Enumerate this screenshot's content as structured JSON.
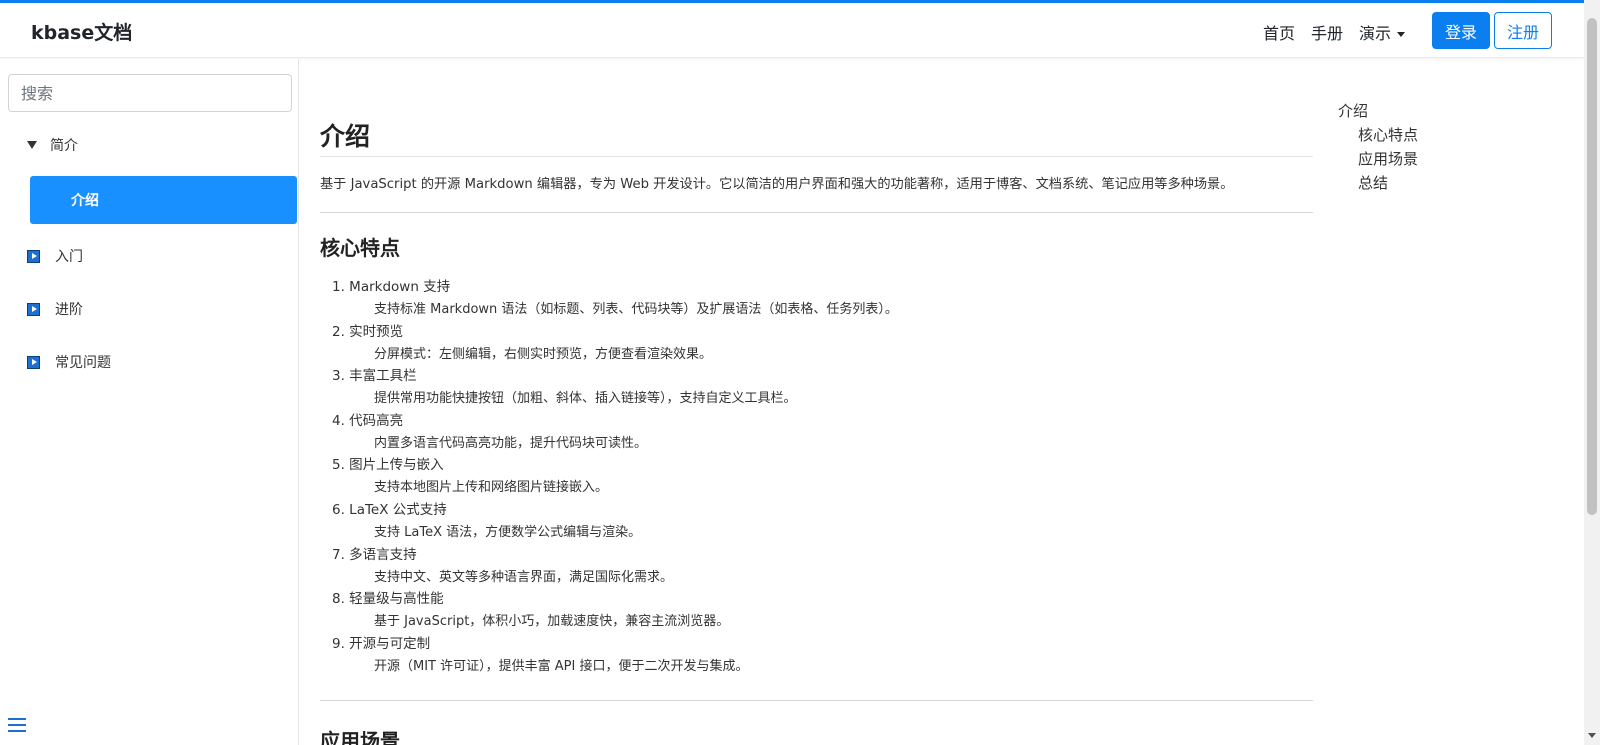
{
  "brand": "kbase文档",
  "nav": {
    "home": "首页",
    "manual": "手册",
    "demo": "演示",
    "login": "登录",
    "register": "注册"
  },
  "sidebar": {
    "search_placeholder": "搜索",
    "sections": [
      {
        "label": "简介",
        "expanded": true
      },
      {
        "label": "入门",
        "expanded": false
      },
      {
        "label": "进阶",
        "expanded": false
      },
      {
        "label": "常见问题",
        "expanded": false
      }
    ],
    "active_item": "介绍"
  },
  "content": {
    "title": "介绍",
    "intro": "基于 JavaScript 的开源 Markdown 编辑器，专为 Web 开发设计。它以简洁的用户界面和强大的功能著称，适用于博客、文档系统、笔记应用等多种场景。",
    "features_heading": "核心特点",
    "features": [
      {
        "title": "1. Markdown 支持",
        "desc": "支持标准 Markdown 语法（如标题、列表、代码块等）及扩展语法（如表格、任务列表）。"
      },
      {
        "title": "2. 实时预览",
        "desc": "分屏模式：左侧编辑，右侧实时预览，方便查看渲染效果。"
      },
      {
        "title": "3. 丰富工具栏",
        "desc": "提供常用功能快捷按钮（加粗、斜体、插入链接等），支持自定义工具栏。"
      },
      {
        "title": "4. 代码高亮",
        "desc": "内置多语言代码高亮功能，提升代码块可读性。"
      },
      {
        "title": "5. 图片上传与嵌入",
        "desc": "支持本地图片上传和网络图片链接嵌入。"
      },
      {
        "title": "6. LaTeX 公式支持",
        "desc": "支持 LaTeX 语法，方便数学公式编辑与渲染。"
      },
      {
        "title": "7. 多语言支持",
        "desc": "支持中文、英文等多种语言界面，满足国际化需求。"
      },
      {
        "title": "8. 轻量级与高性能",
        "desc": "基于 JavaScript，体积小巧，加载速度快，兼容主流浏览器。"
      },
      {
        "title": "9. 开源与可定制",
        "desc": "开源（MIT 许可证），提供丰富 API 接口，便于二次开发与集成。"
      }
    ],
    "scenes_heading": "应用场景"
  },
  "toc": {
    "top": "介绍",
    "items": [
      "核心特点",
      "应用场景",
      "总结"
    ]
  },
  "colors": {
    "accent": "#0b7ff0",
    "active_bg": "#1890ff"
  }
}
